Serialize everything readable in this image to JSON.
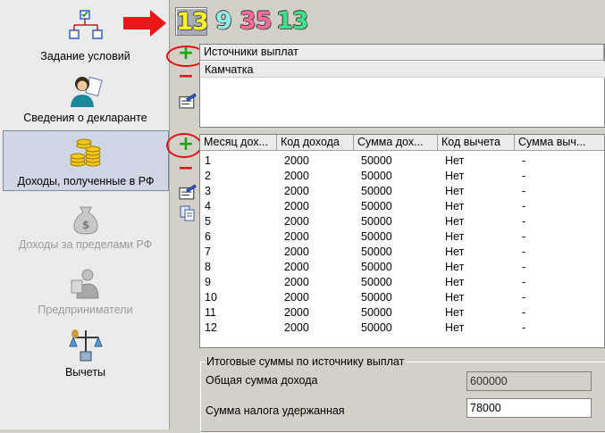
{
  "sidebar": {
    "items": [
      {
        "label": "Задание условий",
        "icon": "flowchart-icon",
        "state": "normal"
      },
      {
        "label": "Сведения о декларанте",
        "icon": "person-icon",
        "state": "normal"
      },
      {
        "label": "Доходы, полученные в РФ",
        "icon": "coins-icon",
        "state": "active"
      },
      {
        "label": "Доходы за пределами РФ",
        "icon": "money-bag-icon",
        "state": "disabled"
      },
      {
        "label": "Предприниматели",
        "icon": "businessman-icon",
        "state": "disabled"
      },
      {
        "label": "Вычеты",
        "icon": "scales-icon",
        "state": "normal"
      }
    ]
  },
  "tabs": {
    "t1": "13",
    "t2": "9",
    "t3": "35",
    "t4": "13",
    "colors": {
      "t1": "#fff22a",
      "t2": "#8ef0e8",
      "t3": "#ff6a9a",
      "t4": "#40e08a"
    }
  },
  "sources": {
    "header": "Источники выплат",
    "rows": [
      "Камчатка"
    ]
  },
  "income": {
    "headers": [
      "Месяц дох...",
      "Код дохода",
      "Сумма дох...",
      "Код вычета",
      "Сумма выч..."
    ],
    "rows": [
      [
        "1",
        "2000",
        "50000",
        "Нет",
        "-"
      ],
      [
        "2",
        "2000",
        "50000",
        "Нет",
        "-"
      ],
      [
        "3",
        "2000",
        "50000",
        "Нет",
        "-"
      ],
      [
        "4",
        "2000",
        "50000",
        "Нет",
        "-"
      ],
      [
        "5",
        "2000",
        "50000",
        "Нет",
        "-"
      ],
      [
        "6",
        "2000",
        "50000",
        "Нет",
        "-"
      ],
      [
        "7",
        "2000",
        "50000",
        "Нет",
        "-"
      ],
      [
        "8",
        "2000",
        "50000",
        "Нет",
        "-"
      ],
      [
        "9",
        "2000",
        "50000",
        "Нет",
        "-"
      ],
      [
        "10",
        "2000",
        "50000",
        "Нет",
        "-"
      ],
      [
        "11",
        "2000",
        "50000",
        "Нет",
        "-"
      ],
      [
        "12",
        "2000",
        "50000",
        "Нет",
        "-"
      ]
    ]
  },
  "totals": {
    "legend": "Итоговые суммы по источнику выплат",
    "income_label": "Общая сумма дохода",
    "income_value": "600000",
    "tax_label": "Сумма налога удержанная",
    "tax_value": "78000"
  },
  "colors": {
    "accent_red": "#e01010",
    "add_green": "#1aa41a",
    "remove_red": "#cc1a1a"
  }
}
